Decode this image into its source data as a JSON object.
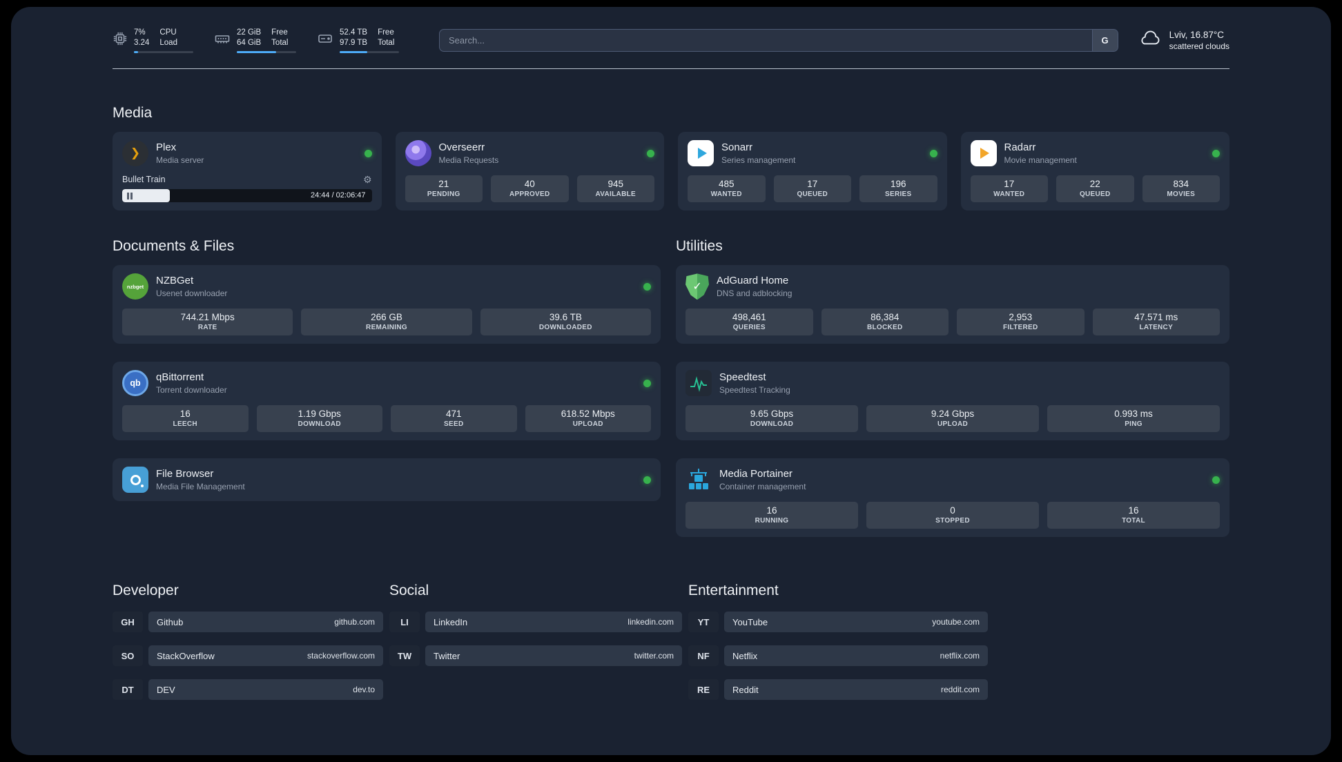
{
  "colors": {
    "background": "#1a2231",
    "card": "#242e3f",
    "stat_tile": "#38414f",
    "accent_blue": "#4dabf7",
    "status_online": "#37b24d",
    "plex_orange": "#e5a00d",
    "sonarr_blue": "#2fa7dd",
    "radarr_amber": "#f2a529",
    "adguard_green": "#5fbd69",
    "speedtest_green": "#27c093",
    "portainer_blue": "#2aa7dd"
  },
  "topbar": {
    "cpu": {
      "icon": "cpu-chip-icon",
      "value": "7%",
      "sub": "3.24",
      "unit_top": "CPU",
      "unit_bottom": "Load",
      "bar": "width:7%"
    },
    "ram": {
      "icon": "memory-icon",
      "value": "22 GiB",
      "sub": "64 GiB",
      "unit_top": "Free",
      "unit_bottom": "Total",
      "bar": "width:66%"
    },
    "disk": {
      "icon": "hard-drive-icon",
      "value": "52.4 TB",
      "sub": "97.9 TB",
      "unit_top": "Free",
      "unit_bottom": "Total",
      "bar": "width:46%"
    },
    "search": {
      "placeholder": "Search...",
      "engine_label": "G"
    },
    "weather": {
      "icon": "cloud-icon",
      "location": "Lviv, 16.87°C",
      "condition": "scattered clouds"
    }
  },
  "sections": {
    "media": "Media",
    "documents": "Documents & Files",
    "utilities": "Utilities",
    "developer": "Developer",
    "social": "Social",
    "entertainment": "Entertainment"
  },
  "apps": {
    "plex": {
      "name": "Plex",
      "desc": "Media server",
      "icon": "plex-icon",
      "status": "online",
      "player": {
        "title": "Bullet Train",
        "time": "24:44 / 02:06:47",
        "progress": "width:19%"
      }
    },
    "overseerr": {
      "name": "Overseerr",
      "desc": "Media Requests",
      "icon": "overseerr-icon",
      "status": "online",
      "stats": [
        {
          "value": "21",
          "label": "PENDING"
        },
        {
          "value": "40",
          "label": "APPROVED"
        },
        {
          "value": "945",
          "label": "AVAILABLE"
        }
      ]
    },
    "sonarr": {
      "name": "Sonarr",
      "desc": "Series management",
      "icon": "sonarr-icon",
      "status": "online",
      "stats": [
        {
          "value": "485",
          "label": "WANTED"
        },
        {
          "value": "17",
          "label": "QUEUED"
        },
        {
          "value": "196",
          "label": "SERIES"
        }
      ]
    },
    "radarr": {
      "name": "Radarr",
      "desc": "Movie management",
      "icon": "radarr-icon",
      "status": "online",
      "stats": [
        {
          "value": "17",
          "label": "WANTED"
        },
        {
          "value": "22",
          "label": "QUEUED"
        },
        {
          "value": "834",
          "label": "MOVIES"
        }
      ]
    },
    "nzbget": {
      "name": "NZBGet",
      "desc": "Usenet downloader",
      "icon": "nzbget-icon",
      "icon_text": "nzbget",
      "status": "online",
      "stats": [
        {
          "value": "744.21 Mbps",
          "label": "RATE"
        },
        {
          "value": "266 GB",
          "label": "REMAINING"
        },
        {
          "value": "39.6 TB",
          "label": "DOWNLOADED"
        }
      ]
    },
    "qbittorrent": {
      "name": "qBittorrent",
      "desc": "Torrent downloader",
      "icon": "qbittorrent-icon",
      "icon_text": "qb",
      "status": "online",
      "stats": [
        {
          "value": "16",
          "label": "LEECH"
        },
        {
          "value": "1.19 Gbps",
          "label": "DOWNLOAD"
        },
        {
          "value": "471",
          "label": "SEED"
        },
        {
          "value": "618.52 Mbps",
          "label": "UPLOAD"
        }
      ]
    },
    "filebrowser": {
      "name": "File Browser",
      "desc": "Media File Management",
      "icon": "filebrowser-icon",
      "status": "online"
    },
    "adguard": {
      "name": "AdGuard Home",
      "desc": "DNS and adblocking",
      "icon": "adguard-shield-icon",
      "stats": [
        {
          "value": "498,461",
          "label": "QUERIES"
        },
        {
          "value": "86,384",
          "label": "BLOCKED"
        },
        {
          "value": "2,953",
          "label": "FILTERED"
        },
        {
          "value": "47.571 ms",
          "label": "LATENCY"
        }
      ]
    },
    "speedtest": {
      "name": "Speedtest",
      "desc": "Speedtest Tracking",
      "icon": "speedtest-sparkline-icon",
      "stats": [
        {
          "value": "9.65 Gbps",
          "label": "DOWNLOAD"
        },
        {
          "value": "9.24 Gbps",
          "label": "UPLOAD"
        },
        {
          "value": "0.993 ms",
          "label": "PING"
        }
      ]
    },
    "portainer": {
      "name": "Media Portainer",
      "desc": "Container management",
      "icon": "portainer-crane-icon",
      "status": "online",
      "stats": [
        {
          "value": "16",
          "label": "RUNNING"
        },
        {
          "value": "0",
          "label": "STOPPED"
        },
        {
          "value": "16",
          "label": "TOTAL"
        }
      ]
    }
  },
  "bookmarks": {
    "developer": [
      {
        "abbr": "GH",
        "name": "Github",
        "url": "github.com"
      },
      {
        "abbr": "SO",
        "name": "StackOverflow",
        "url": "stackoverflow.com"
      },
      {
        "abbr": "DT",
        "name": "DEV",
        "url": "dev.to"
      }
    ],
    "social": [
      {
        "abbr": "LI",
        "name": "LinkedIn",
        "url": "linkedin.com"
      },
      {
        "abbr": "TW",
        "name": "Twitter",
        "url": "twitter.com"
      }
    ],
    "entertainment": [
      {
        "abbr": "YT",
        "name": "YouTube",
        "url": "youtube.com"
      },
      {
        "abbr": "NF",
        "name": "Netflix",
        "url": "netflix.com"
      },
      {
        "abbr": "RE",
        "name": "Reddit",
        "url": "reddit.com"
      }
    ]
  }
}
